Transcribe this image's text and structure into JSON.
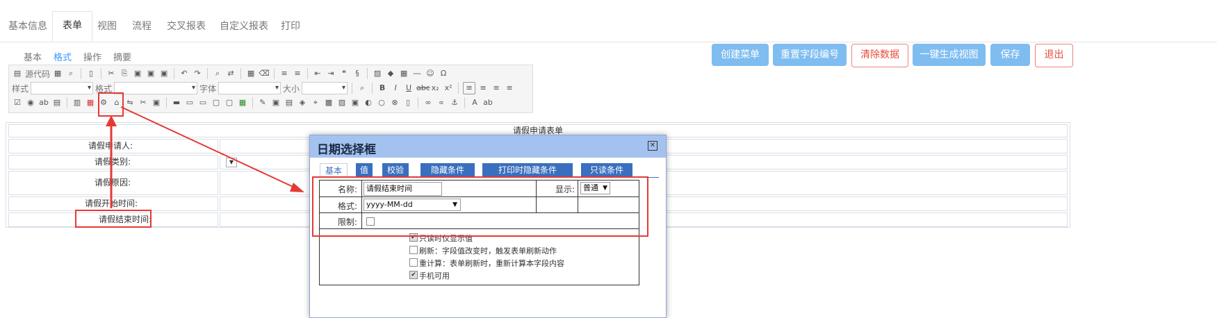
{
  "main_tabs": [
    "基本信息",
    "表单",
    "视图",
    "流程",
    "交叉报表",
    "自定义报表",
    "打印"
  ],
  "sub_tabs": [
    "基本",
    "格式",
    "操作",
    "摘要"
  ],
  "buttons": {
    "create_menu": "创建菜单",
    "reset_field_numbers": "重置字段编号",
    "clear_data": "清除数据",
    "one_click_view": "一键生成视图",
    "save": "保存",
    "exit": "退出"
  },
  "toolbar": {
    "source_code": "源代码",
    "style": "样式",
    "format": "格式",
    "font": "字体",
    "size": "大小"
  },
  "form": {
    "title": "请假申请表单",
    "labels": [
      "请假申请人:",
      "请假类别:",
      "请假原因:",
      "请假开始时间:",
      "请假结束时间:"
    ]
  },
  "dialog": {
    "title": "日期选择框",
    "close": "☒",
    "tabs": [
      "基本",
      "值",
      "校验",
      "隐藏条件",
      "打印时隐藏条件",
      "只读条件"
    ],
    "name_label": "名称:",
    "name_value": "请假结束时间",
    "display_label": "显示:",
    "display_value": "普通",
    "format_label": "格式:",
    "format_value": "yyyy-MM-dd",
    "limit_label": "限制:",
    "options": [
      {
        "label": "只读时仅显示值",
        "checked": true
      },
      {
        "label": "刷新：字段值改变时，触发表单刷新动作",
        "checked": false
      },
      {
        "label": "重计算：表单刷新时，重新计算本字段内容",
        "checked": false
      },
      {
        "label": "手机可用",
        "checked": true
      }
    ]
  },
  "colors": {
    "accent_blue": "#3399ff",
    "button_blue": "#7fbdf0",
    "highlight_red": "#e53935",
    "dialog_header": "#a4c2ef"
  }
}
